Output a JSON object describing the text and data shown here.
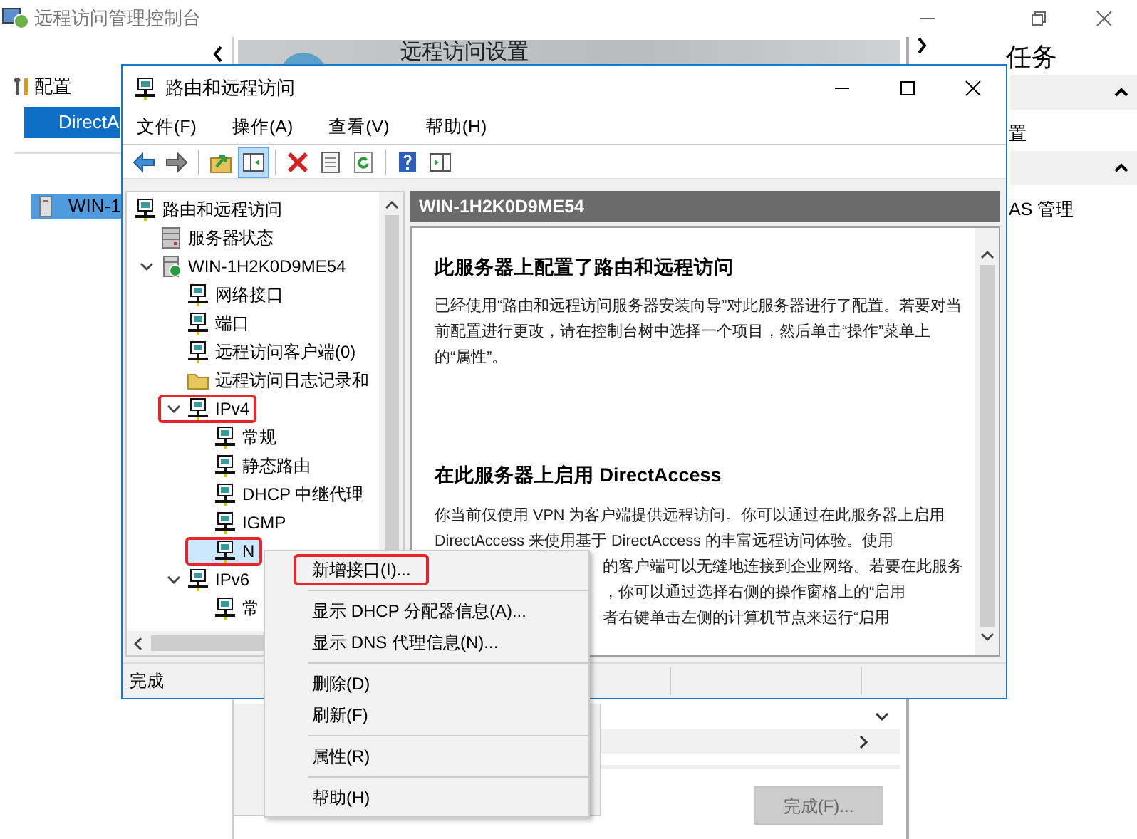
{
  "console": {
    "title": "远程访问管理控制台",
    "nav": [
      {
        "label": "配置",
        "kind": "heading",
        "selected": false
      },
      {
        "label": "DirectA",
        "kind": "entry",
        "selected": true
      },
      {
        "label": "WIN-1",
        "kind": "server",
        "selected": true
      }
    ],
    "banner_title": "远程访问设置",
    "tasks": {
      "title": "任务",
      "sections": [
        {
          "item": "置",
          "expanded": true
        },
        {
          "item": "AS 管理",
          "expanded": true
        }
      ]
    },
    "finish_button": {
      "label": "完成(F)...",
      "disabled": true
    }
  },
  "mmc": {
    "title": "路由和远程访问",
    "menu": [
      "文件(F)",
      "操作(A)",
      "查看(V)",
      "帮助(H)"
    ],
    "toolbar": [
      {
        "kind": "back",
        "pressed": false
      },
      {
        "kind": "forward",
        "pressed": false
      },
      {
        "kind": "separator"
      },
      {
        "kind": "up",
        "pressed": false
      },
      {
        "kind": "tree",
        "pressed": true
      },
      {
        "kind": "separator"
      },
      {
        "kind": "delete",
        "pressed": false
      },
      {
        "kind": "properties",
        "pressed": false
      },
      {
        "kind": "refresh",
        "pressed": false
      },
      {
        "kind": "separator"
      },
      {
        "kind": "help",
        "pressed": false
      },
      {
        "kind": "action-pane",
        "pressed": false
      }
    ],
    "tree": [
      {
        "label": "路由和远程访问",
        "kind": "router",
        "selected": false,
        "highlighted": false,
        "children": [
          {
            "label": "服务器状态",
            "kind": "status",
            "selected": false,
            "highlighted": false
          },
          {
            "label": "WIN-1H2K0D9ME54",
            "kind": "server",
            "expanded": true,
            "selected": false,
            "highlighted": false,
            "children": [
              {
                "label": "网络接口",
                "kind": "router",
                "selected": false,
                "highlighted": false
              },
              {
                "label": "端口",
                "kind": "router",
                "selected": false,
                "highlighted": false
              },
              {
                "label": "远程访问客户端(0)",
                "kind": "router",
                "selected": false,
                "highlighted": false
              },
              {
                "label": "远程访问日志记录和",
                "kind": "folder",
                "selected": false,
                "highlighted": false
              },
              {
                "label": "IPv4",
                "kind": "router",
                "expanded": true,
                "selected": false,
                "highlighted": true,
                "children": [
                  {
                    "label": "常规",
                    "kind": "router",
                    "selected": false,
                    "highlighted": false
                  },
                  {
                    "label": "静态路由",
                    "kind": "router",
                    "selected": false,
                    "highlighted": false
                  },
                  {
                    "label": "DHCP 中继代理",
                    "kind": "router",
                    "selected": false,
                    "highlighted": false
                  },
                  {
                    "label": "IGMP",
                    "kind": "router",
                    "selected": false,
                    "highlighted": false
                  },
                  {
                    "label": "N",
                    "kind": "router",
                    "selected": true,
                    "highlighted": true
                  }
                ]
              },
              {
                "label": "IPv6",
                "kind": "router",
                "expanded": true,
                "selected": false,
                "highlighted": false,
                "children": [
                  {
                    "label": "常",
                    "kind": "router",
                    "selected": false,
                    "highlighted": false
                  }
                ]
              }
            ]
          }
        ]
      }
    ],
    "detail": {
      "header": "WIN-1H2K0D9ME54",
      "sections": [
        {
          "heading": "此服务器上配置了路由和远程访问",
          "lines": [
            {
              "text": "已经使用“路由和远程访问服务器安装向导”对此服务器进行了配置。若要对当前配置进行更改，请在控制台树中选择一个项目，然后单击“操作”菜单上的“属性”。",
              "kind": "full"
            }
          ]
        },
        {
          "heading": "在此服务器上启用 DirectAccess",
          "lines": [
            {
              "text": "你当前仅使用 VPN 为客户端提供远程访问。你可以通过在此服务器上启用",
              "kind": "full"
            },
            {
              "text": "DirectAccess 来使用基于 DirectAccess 的丰富远程访问体验。使用",
              "kind": "full"
            },
            {
              "text": "的客户端可以无缝地连接到企业网络。若要在此服务",
              "kind": "covered"
            },
            {
              "text": "，你可以通过选择右侧的操作窗格上的“启用",
              "kind": "covered"
            },
            {
              "text": "者右键单击左侧的计算机节点来运行“启用",
              "kind": "covered"
            }
          ]
        }
      ]
    },
    "status": "完成"
  },
  "context_menu": [
    {
      "kind": "item",
      "label": "新增接口(I)...",
      "highlighted": true
    },
    {
      "kind": "separator"
    },
    {
      "kind": "item",
      "label": "显示 DHCP 分配器信息(A)...",
      "highlighted": false
    },
    {
      "kind": "item",
      "label": "显示 DNS 代理信息(N)...",
      "highlighted": false
    },
    {
      "kind": "separator"
    },
    {
      "kind": "item",
      "label": "删除(D)",
      "highlighted": false
    },
    {
      "kind": "item",
      "label": "刷新(F)",
      "highlighted": false
    },
    {
      "kind": "separator"
    },
    {
      "kind": "item",
      "label": "属性(R)",
      "highlighted": false
    },
    {
      "kind": "separator"
    },
    {
      "kind": "item",
      "label": "帮助(H)",
      "highlighted": false
    }
  ]
}
